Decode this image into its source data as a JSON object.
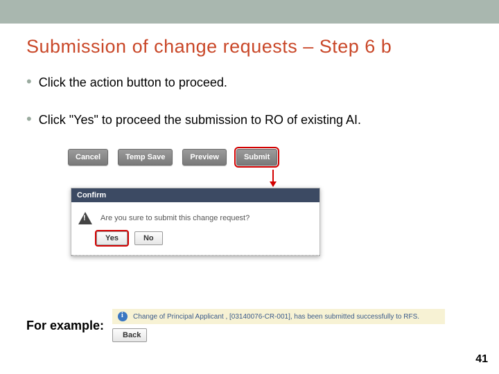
{
  "slide": {
    "title": "Submission of change requests – Step 6 b",
    "bullets": [
      "Click the action button to proceed.",
      "Click \"Yes\" to proceed the submission to RO of existing AI."
    ],
    "example_label": "For example:",
    "page_number": "41"
  },
  "button_row": {
    "cancel": "Cancel",
    "temp_save": "Temp Save",
    "preview": "Preview",
    "submit": "Submit"
  },
  "confirm_dialog": {
    "title": "Confirm",
    "message": "Are you sure to submit this change request?",
    "yes": "Yes",
    "no": "No"
  },
  "success_bar": {
    "message": "Change of Principal Applicant , [03140076-CR-001], has been submitted successfully to RFS."
  },
  "back_button": {
    "label": "Back"
  }
}
